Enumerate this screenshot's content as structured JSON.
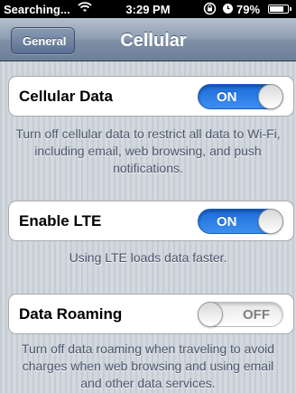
{
  "status_bar": {
    "carrier": "Searching...",
    "wifi_icon": "wifi-icon",
    "time": "3:29 PM",
    "lock_icon": "rotation-lock-icon",
    "alarm_icon": "alarm-icon",
    "battery_percent": "79%",
    "battery_level": 0.79
  },
  "nav": {
    "back_label": "General",
    "title": "Cellular"
  },
  "settings": {
    "cellular_data": {
      "label": "Cellular Data",
      "state": "ON",
      "footer": "Turn off cellular data to restrict all data to Wi-Fi, including email, web browsing, and push notifications."
    },
    "enable_lte": {
      "label": "Enable LTE",
      "state": "ON",
      "footer": "Using LTE loads data faster."
    },
    "data_roaming": {
      "label": "Data Roaming",
      "state": "OFF",
      "footer": "Turn off data roaming when traveling to avoid charges when web browsing and using email and other data services."
    }
  },
  "colors": {
    "toggle_on": "#2f80e8",
    "nav_bar": "#8e9db1",
    "footer_text": "#4c566c"
  }
}
